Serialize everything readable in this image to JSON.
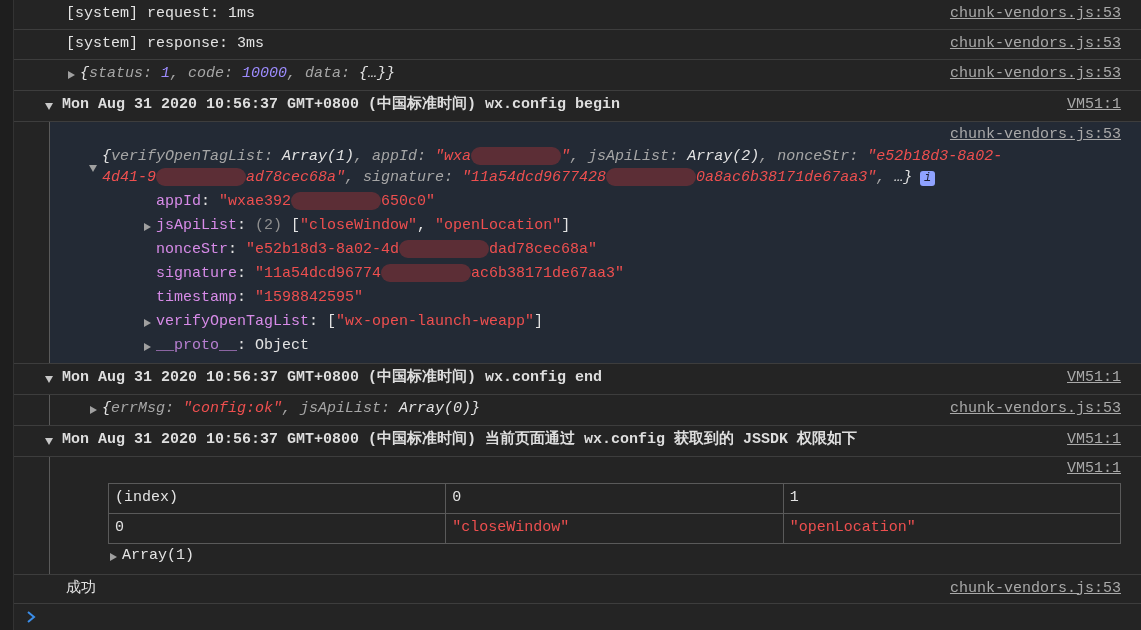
{
  "messages": [
    {
      "kind": "log",
      "text": "[system] request: 1ms",
      "source": "chunk-vendors.js:53"
    },
    {
      "kind": "log",
      "text": "[system] response: 3ms",
      "source": "chunk-vendors.js:53"
    },
    {
      "kind": "object",
      "expanded": false,
      "source": "chunk-vendors.js:53",
      "lines": [
        [
          {
            "kind": "plain",
            "text": "{"
          },
          {
            "kind": "pkey",
            "text": "status: "
          },
          {
            "kind": "num",
            "text": "1"
          },
          {
            "kind": "pkey",
            "text": ", code: "
          },
          {
            "kind": "num",
            "text": "10000"
          },
          {
            "kind": "pkey",
            "text": ", data: "
          },
          {
            "kind": "plain",
            "text": "{…}}"
          }
        ]
      ]
    },
    {
      "kind": "group",
      "expanded": true,
      "title": "Mon Aug 31 2020 10:56:37 GMT+0800 (中国标准时间) wx.config begin",
      "source": "VM51:1",
      "children": [
        {
          "kind": "object",
          "expanded": true,
          "highlighted": true,
          "source": "chunk-vendors.js:53",
          "badge": "i",
          "lines": [
            [
              {
                "kind": "plain",
                "text": "{"
              },
              {
                "kind": "pkey",
                "text": "verifyOpenTagList: "
              },
              {
                "kind": "plain",
                "text": "Array(1)"
              },
              {
                "kind": "pkey",
                "text": ", appId: "
              },
              {
                "kind": "str",
                "text": "\"wxa"
              },
              {
                "kind": "redacted"
              },
              {
                "kind": "str",
                "text": "\""
              },
              {
                "kind": "pkey",
                "text": ", jsApiList: "
              },
              {
                "kind": "plain",
                "text": "Array(2)"
              },
              {
                "kind": "pkey",
                "text": ", nonceStr: "
              },
              {
                "kind": "str",
                "text": "\"e52b18d3-8a02-"
              }
            ],
            [
              {
                "kind": "str",
                "text": "4d41-9"
              },
              {
                "kind": "redacted"
              },
              {
                "kind": "str",
                "text": "ad78cec68a\""
              },
              {
                "kind": "pkey",
                "text": ", signature: "
              },
              {
                "kind": "str",
                "text": "\"11a54dcd9677428"
              },
              {
                "kind": "redacted"
              },
              {
                "kind": "str",
                "text": "0a8ac6b38171de67aa3\""
              },
              {
                "kind": "pkey",
                "text": ", "
              },
              {
                "kind": "plain",
                "text": "…}"
              }
            ]
          ],
          "properties": [
            {
              "segments": [
                {
                  "kind": "key",
                  "text": "appId"
                },
                {
                  "kind": "plain",
                  "text": ": "
                },
                {
                  "kind": "str",
                  "text": "\"wxae392"
                },
                {
                  "kind": "redacted"
                },
                {
                  "kind": "str",
                  "text": "650c0\""
                }
              ]
            },
            {
              "expanded": false,
              "segments": [
                {
                  "kind": "key",
                  "text": "jsApiList"
                },
                {
                  "kind": "plain",
                  "text": ": "
                },
                {
                  "kind": "dim",
                  "text": "(2) "
                },
                {
                  "kind": "plain",
                  "text": "["
                },
                {
                  "kind": "str",
                  "text": "\"closeWindow\""
                },
                {
                  "kind": "plain",
                  "text": ", "
                },
                {
                  "kind": "str",
                  "text": "\"openLocation\""
                },
                {
                  "kind": "plain",
                  "text": "]"
                }
              ]
            },
            {
              "segments": [
                {
                  "kind": "key",
                  "text": "nonceStr"
                },
                {
                  "kind": "plain",
                  "text": ": "
                },
                {
                  "kind": "str",
                  "text": "\"e52b18d3-8a02-4d"
                },
                {
                  "kind": "redacted"
                },
                {
                  "kind": "str",
                  "text": "dad78cec68a\""
                }
              ]
            },
            {
              "segments": [
                {
                  "kind": "key",
                  "text": "signature"
                },
                {
                  "kind": "plain",
                  "text": ": "
                },
                {
                  "kind": "str",
                  "text": "\"11a54dcd96774"
                },
                {
                  "kind": "redacted"
                },
                {
                  "kind": "str",
                  "text": "ac6b38171de67aa3\""
                }
              ]
            },
            {
              "segments": [
                {
                  "kind": "key",
                  "text": "timestamp"
                },
                {
                  "kind": "plain",
                  "text": ": "
                },
                {
                  "kind": "str",
                  "text": "\"1598842595\""
                }
              ]
            },
            {
              "expanded": false,
              "segments": [
                {
                  "kind": "key",
                  "text": "verifyOpenTagList"
                },
                {
                  "kind": "plain",
                  "text": ": ["
                },
                {
                  "kind": "str",
                  "text": "\"wx-open-launch-weapp\""
                },
                {
                  "kind": "plain",
                  "text": "]"
                }
              ]
            },
            {
              "expanded": false,
              "segments": [
                {
                  "kind": "proto",
                  "text": "__proto__"
                },
                {
                  "kind": "plain",
                  "text": ": Object"
                }
              ]
            }
          ]
        }
      ]
    },
    {
      "kind": "group",
      "expanded": true,
      "title": "Mon Aug 31 2020 10:56:37 GMT+0800 (中国标准时间) wx.config end",
      "source": "VM51:1",
      "children": [
        {
          "kind": "object",
          "expanded": false,
          "source": "chunk-vendors.js:53",
          "lines": [
            [
              {
                "kind": "plain",
                "text": "{"
              },
              {
                "kind": "pkey",
                "text": "errMsg: "
              },
              {
                "kind": "str",
                "text": "\"config:ok\""
              },
              {
                "kind": "pkey",
                "text": ", jsApiList: "
              },
              {
                "kind": "plain",
                "text": "Array(0)}"
              }
            ]
          ]
        }
      ]
    },
    {
      "kind": "group",
      "expanded": true,
      "title": "Mon Aug 31 2020 10:56:37 GMT+0800 (中国标准时间) 当前页面通过 wx.config 获取到的 JSSDK 权限如下",
      "source": "VM51:1",
      "children": [
        {
          "kind": "table",
          "source": "VM51:1",
          "columns": [
            "(index)",
            "0",
            "1"
          ],
          "rows": [
            [
              {
                "kind": "plain",
                "text": "0"
              },
              {
                "kind": "str",
                "text": "\"closeWindow\""
              },
              {
                "kind": "str",
                "text": "\"openLocation\""
              }
            ]
          ],
          "footer": {
            "expanded": false,
            "text": "Array(1)"
          }
        }
      ]
    },
    {
      "kind": "log",
      "text": "成功",
      "source": "chunk-vendors.js:53"
    }
  ]
}
